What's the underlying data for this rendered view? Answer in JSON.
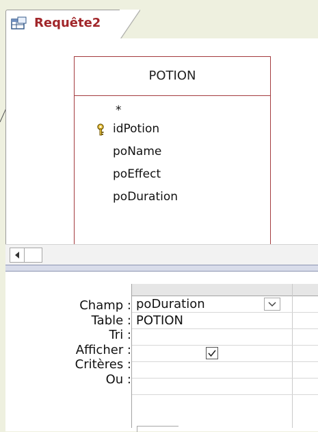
{
  "tab": {
    "title": "Requête2",
    "icon": "query-icon"
  },
  "table": {
    "name": "POTION",
    "fields": [
      {
        "label": "*",
        "primary_key": false
      },
      {
        "label": "idPotion",
        "primary_key": true,
        "icon": "key-icon"
      },
      {
        "label": "poName",
        "primary_key": false
      },
      {
        "label": "poEffect",
        "primary_key": false
      },
      {
        "label": "poDuration",
        "primary_key": false
      }
    ]
  },
  "grid": {
    "row_labels": {
      "champ": "Champ :",
      "table": "Table :",
      "tri": "Tri :",
      "afficher": "Afficher :",
      "criteres": "Critères :",
      "ou": "Ou :"
    },
    "column1": {
      "champ": "poDuration",
      "table": "POTION",
      "tri": "",
      "afficher_checked": true,
      "criteres": "",
      "ou": ""
    }
  },
  "colors": {
    "tab_text": "#a1262a",
    "table_border": "#a33a3d",
    "background": "#eef0df"
  }
}
